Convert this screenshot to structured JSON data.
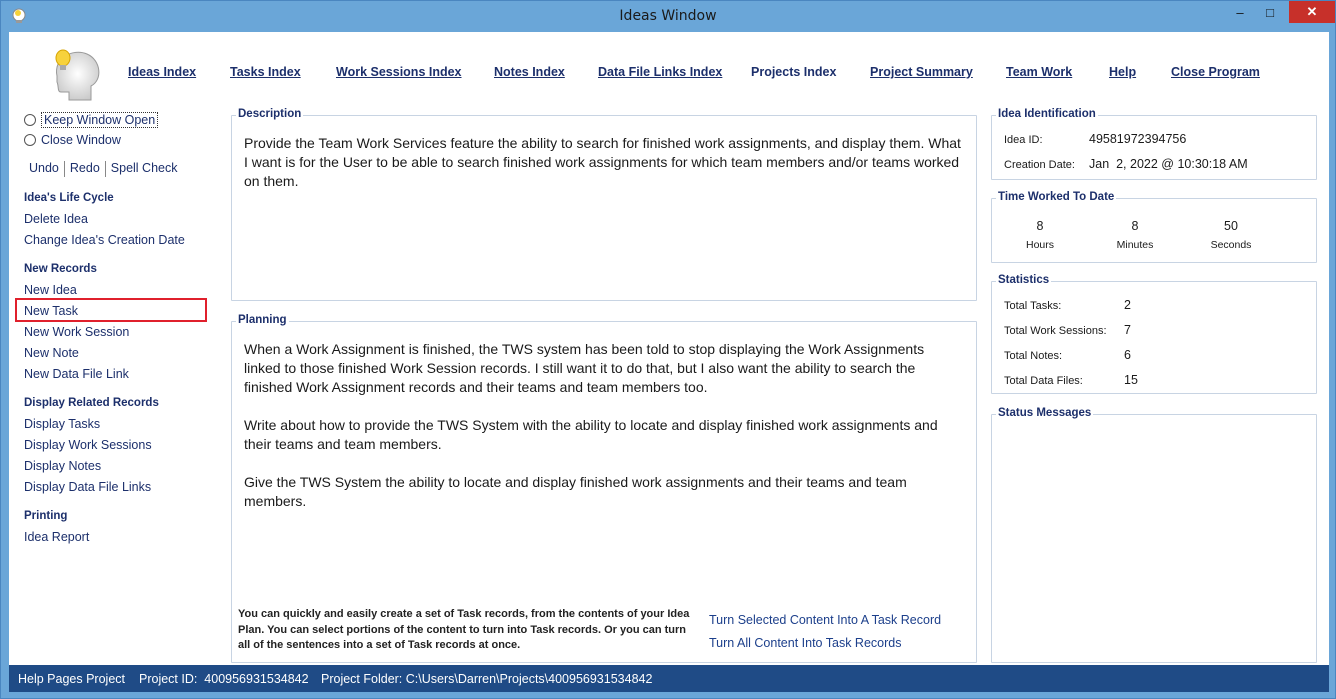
{
  "window": {
    "title": "Ideas Window"
  },
  "nav": [
    {
      "accel": "I",
      "rest": "deas Index"
    },
    {
      "accel": "T",
      "rest": "asks Index"
    },
    {
      "accel": "W",
      "rest": "ork Sessions Index"
    },
    {
      "accel": "N",
      "rest": "otes Index"
    },
    {
      "accel": "D",
      "rest": "ata File Links Index"
    },
    {
      "accel": "",
      "rest": "Projects Index"
    },
    {
      "accel": "P",
      "rest": "roject Summary"
    },
    {
      "accel": "",
      "rest": "Team Work"
    },
    {
      "accel": "H",
      "rest": "elp"
    },
    {
      "accel": "C",
      "rest": "lose Program"
    }
  ],
  "nav_full": [
    "Ideas Index",
    "Tasks Index",
    "Work Sessions Index",
    "Notes Index",
    "Data File Links Index",
    "Projects Index",
    "Project Summary",
    "Team Work",
    "Help",
    "Close Program"
  ],
  "sidebar": {
    "keep_open": "Keep Window Open",
    "close_window": "Close Window",
    "undo": "Undo",
    "redo": "Redo",
    "spell_check": "Spell Check",
    "life_cycle_head": "Idea's Life Cycle",
    "delete_idea": "Delete Idea",
    "change_date": "Change Idea's Creation Date",
    "new_records_head": "New Records",
    "new_idea": "New Idea",
    "new_task": "New Task",
    "new_work_session": "New Work Session",
    "new_note": "New Note",
    "new_data_file_link": "New Data File Link",
    "display_head": "Display Related Records",
    "display_tasks": "Display Tasks",
    "display_work_sessions": "Display Work Sessions",
    "display_notes": "Display Notes",
    "display_data_file_links": "Display Data File Links",
    "printing_head": "Printing",
    "idea_report": "Idea Report"
  },
  "description": {
    "label": "Description",
    "text": "Provide the Team Work Services feature the ability to search for finished work assignments, and display them. What I want is for the User to be able to search finished work assignments for which team members and/or teams worked on them."
  },
  "planning": {
    "label": "Planning",
    "paragraphs": [
      "When a Work Assignment is finished, the TWS system has been told to stop displaying the Work Assignments linked to those finished Work Session records. I still want it to do that, but I also want the ability to search the finished Work Assignment records and their teams and team members too.",
      "Write about how to provide the TWS System with the ability to locate and display finished work assignments and their teams and team members.",
      "Give the TWS System the ability to locate and display finished work assignments and their teams and team members."
    ],
    "footnote": "You can quickly and easily create a set of Task records, from the contents of your Idea Plan. You can select portions of the content to turn into Task records. Or you can turn all of the sentences into a set of Task records at once.",
    "turn_selected": "Turn Selected Content Into A Task Record",
    "turn_all": "Turn All Content Into Task Records"
  },
  "identification": {
    "label": "Idea Identification",
    "id_label": "Idea ID:",
    "id_value": "49581972394756",
    "date_label": "Creation Date:",
    "date_value": "Jan  2, 2022 @ 10:30:18 AM"
  },
  "time_worked": {
    "label": "Time Worked To Date",
    "hours": "8",
    "hours_label": "Hours",
    "minutes": "8",
    "minutes_label": "Minutes",
    "seconds": "50",
    "seconds_label": "Seconds"
  },
  "statistics": {
    "label": "Statistics",
    "tasks_label": "Total Tasks:",
    "tasks": "2",
    "sessions_label": "Total Work Sessions:",
    "sessions": "7",
    "notes_label": "Total Notes:",
    "notes": "6",
    "files_label": "Total Data Files:",
    "files": "15"
  },
  "status_messages": {
    "label": "Status Messages"
  },
  "statusbar": {
    "project": "Help Pages Project",
    "project_id": "Project ID:  400956931534842",
    "project_folder": "Project Folder: C:\\Users\\Darren\\Projects\\400956931534842"
  },
  "colors": {
    "frame": "#6aa6d8",
    "statusbar": "#1f4b86",
    "link": "#1c2f6b",
    "highlight": "#e0202c",
    "close": "#c7302a"
  }
}
